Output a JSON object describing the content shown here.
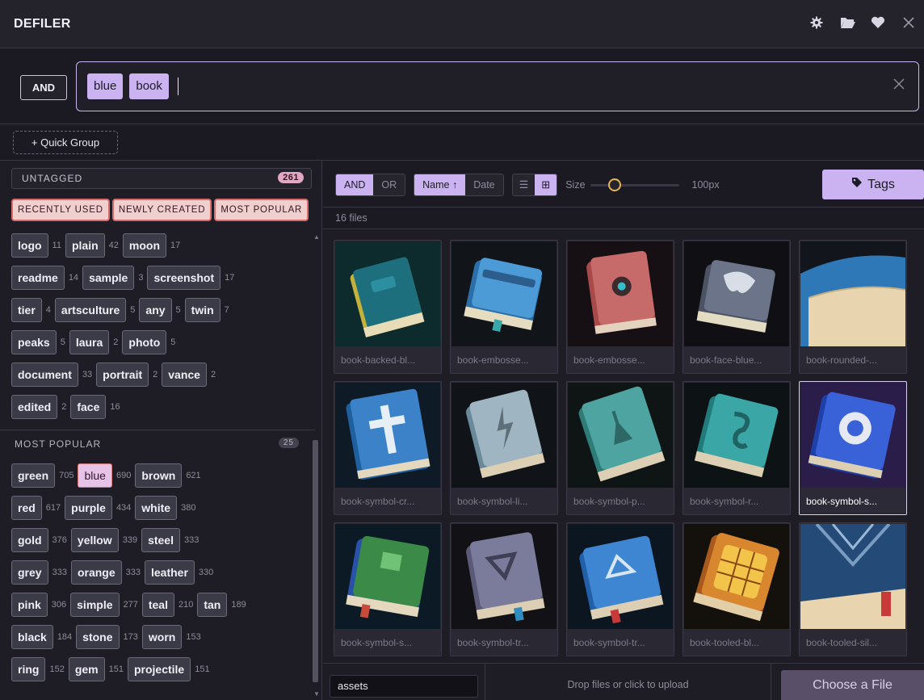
{
  "app": {
    "title": "DEFILER"
  },
  "header_icons": [
    "gear-icon",
    "folder-open-icon",
    "heart-icon",
    "close-icon"
  ],
  "search": {
    "mode": "AND",
    "terms": [
      "blue",
      "book"
    ],
    "clear_icon": "close-icon"
  },
  "quick_group": {
    "label": "+ Quick Group"
  },
  "sidebar": {
    "untagged": {
      "label": "UNTAGGED",
      "count": "261"
    },
    "sort_buttons": [
      "RECENTLY USED",
      "NEWLY CREATED",
      "MOST POPULAR"
    ],
    "tags": [
      {
        "label": "logo",
        "count": "11"
      },
      {
        "label": "plain",
        "count": "42"
      },
      {
        "label": "moon",
        "count": "17"
      },
      {
        "label": "readme",
        "count": "14"
      },
      {
        "label": "sample",
        "count": "3"
      },
      {
        "label": "screenshot",
        "count": "17"
      },
      {
        "label": "tier",
        "count": "4"
      },
      {
        "label": "artsculture",
        "count": "5"
      },
      {
        "label": "any",
        "count": "5"
      },
      {
        "label": "twin",
        "count": "7"
      },
      {
        "label": "peaks",
        "count": "5"
      },
      {
        "label": "laura",
        "count": "2"
      },
      {
        "label": "photo",
        "count": "5"
      },
      {
        "label": "document",
        "count": "33"
      },
      {
        "label": "portrait",
        "count": "2"
      },
      {
        "label": "vance",
        "count": "2"
      },
      {
        "label": "edited",
        "count": "2"
      },
      {
        "label": "face",
        "count": "16"
      }
    ],
    "most_popular": {
      "label": "MOST POPULAR",
      "count": "25",
      "tags": [
        {
          "label": "green",
          "count": "705"
        },
        {
          "label": "blue",
          "count": "690",
          "selected": true
        },
        {
          "label": "brown",
          "count": "621"
        },
        {
          "label": "red",
          "count": "617"
        },
        {
          "label": "purple",
          "count": "434"
        },
        {
          "label": "white",
          "count": "380"
        },
        {
          "label": "gold",
          "count": "376"
        },
        {
          "label": "yellow",
          "count": "339"
        },
        {
          "label": "steel",
          "count": "333"
        },
        {
          "label": "grey",
          "count": "333"
        },
        {
          "label": "orange",
          "count": "333"
        },
        {
          "label": "leather",
          "count": "330"
        },
        {
          "label": "pink",
          "count": "306"
        },
        {
          "label": "simple",
          "count": "277"
        },
        {
          "label": "teal",
          "count": "210"
        },
        {
          "label": "tan",
          "count": "189"
        },
        {
          "label": "black",
          "count": "184"
        },
        {
          "label": "stone",
          "count": "173"
        },
        {
          "label": "worn",
          "count": "153"
        },
        {
          "label": "ring",
          "count": "152"
        },
        {
          "label": "gem",
          "count": "151"
        },
        {
          "label": "projectile",
          "count": "151"
        }
      ]
    }
  },
  "toolbar": {
    "logic": {
      "on": "AND",
      "off": "OR"
    },
    "sort": {
      "on": "Name ↑",
      "off": "Date"
    },
    "view": {
      "list_icon": "list-icon",
      "grid_icon": "grid-icon",
      "active": "grid"
    },
    "size_label": "Size",
    "size_value": "100px",
    "tags_button": "Tags"
  },
  "file_count": "16 files",
  "files": [
    {
      "name": "book-backed-bl...",
      "hue": "teal-gold"
    },
    {
      "name": "book-embosse...",
      "hue": "blue"
    },
    {
      "name": "book-embosse...",
      "hue": "red"
    },
    {
      "name": "book-face-blue...",
      "hue": "slate"
    },
    {
      "name": "book-rounded-...",
      "hue": "blue-tan"
    },
    {
      "name": "book-symbol-cr...",
      "hue": "blue"
    },
    {
      "name": "book-symbol-li...",
      "hue": "grey-blue"
    },
    {
      "name": "book-symbol-p...",
      "hue": "teal"
    },
    {
      "name": "book-symbol-r...",
      "hue": "teal"
    },
    {
      "name": "book-symbol-s...",
      "hue": "royal-blue",
      "selected": true
    },
    {
      "name": "book-symbol-s...",
      "hue": "green-blue"
    },
    {
      "name": "book-symbol-tr...",
      "hue": "grey-violet"
    },
    {
      "name": "book-symbol-tr...",
      "hue": "blue"
    },
    {
      "name": "book-tooled-bl...",
      "hue": "orange"
    },
    {
      "name": "book-tooled-sil...",
      "hue": "navy"
    }
  ],
  "footer": {
    "folder": "assets",
    "drop_text": "Drop files or click to upload",
    "choose_button": "Choose a File"
  },
  "colors": {
    "accent": "#cbb3f2",
    "background": "#1b1a22",
    "badge": "#e0a8c2",
    "sort_button": "#f0cfcf"
  }
}
